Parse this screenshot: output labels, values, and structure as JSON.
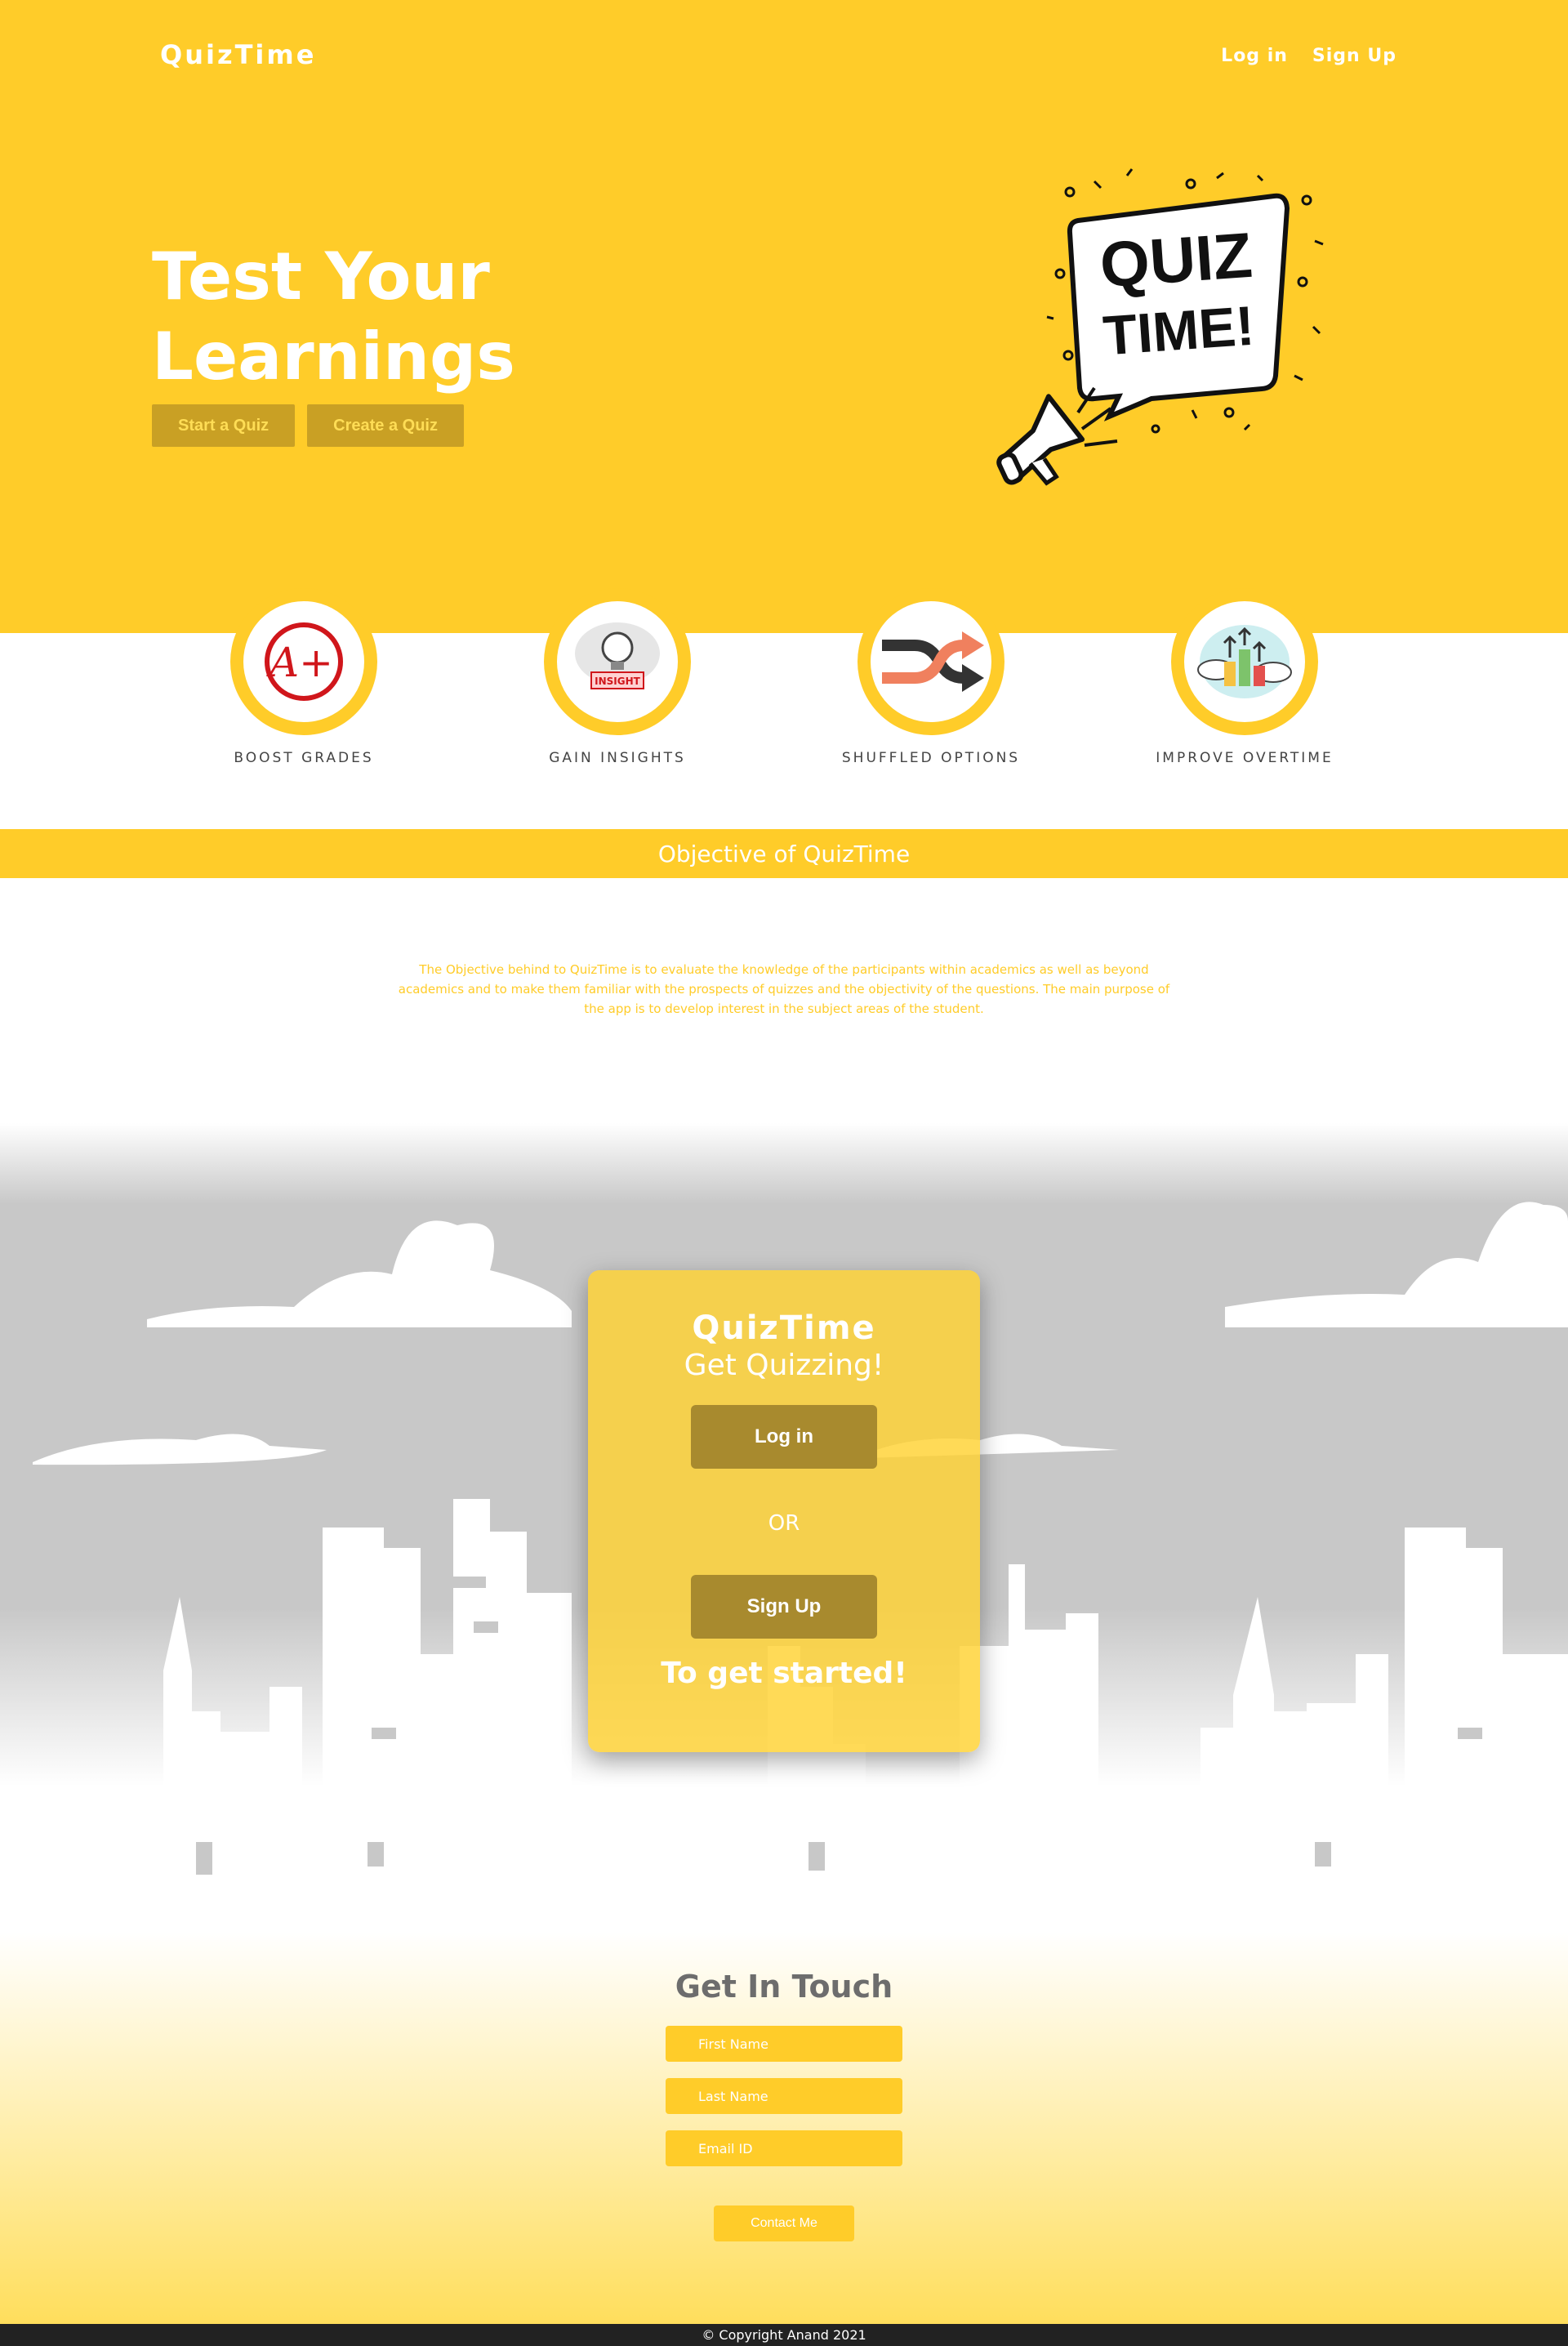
{
  "header": {
    "brand": "QuizTime",
    "nav": {
      "login": "Log in",
      "signup": "Sign Up"
    }
  },
  "hero": {
    "title_line1": "Test Your",
    "title_line2": "Learnings",
    "start_button": "Start a Quiz",
    "create_button": "Create a Quiz",
    "art": {
      "line1": "QUIZ",
      "line2": "TIME!"
    }
  },
  "features": [
    {
      "label": "BOOST GRADES",
      "icon": "grade-a-plus-icon",
      "badge": "A+"
    },
    {
      "label": "GAIN INSIGHTS",
      "icon": "insight-bulb-icon",
      "badge": "INSIGHT"
    },
    {
      "label": "SHUFFLED OPTIONS",
      "icon": "shuffle-icon"
    },
    {
      "label": "IMPROVE OVERTIME",
      "icon": "growth-chart-icon"
    }
  ],
  "objective": {
    "heading": "Objective of QuizTime",
    "text": "The Objective behind to QuizTime is to evaluate the knowledge of the participants within academics as well as beyond academics and to make them familiar with the prospects of quizzes and the objectivity of the questions. The main purpose of the app is to develop interest in the subject areas of the student."
  },
  "cta_card": {
    "title": "QuizTime",
    "subtitle": "Get Quizzing!",
    "login": "Log in",
    "or": "OR",
    "signup": "Sign Up",
    "footer": "To get started!"
  },
  "contact": {
    "title": "Get In Touch",
    "first_name_placeholder": "First Name",
    "last_name_placeholder": "Last Name",
    "email_placeholder": "Email ID",
    "submit": "Contact Me"
  },
  "footer": {
    "copyright": "© Copyright Anand 2021"
  },
  "colors": {
    "brand_yellow": "#ffcc29",
    "button_dark": "#a88a2e",
    "sky_gray": "#c8c8c8",
    "text_gray": "#6d6d6d"
  }
}
